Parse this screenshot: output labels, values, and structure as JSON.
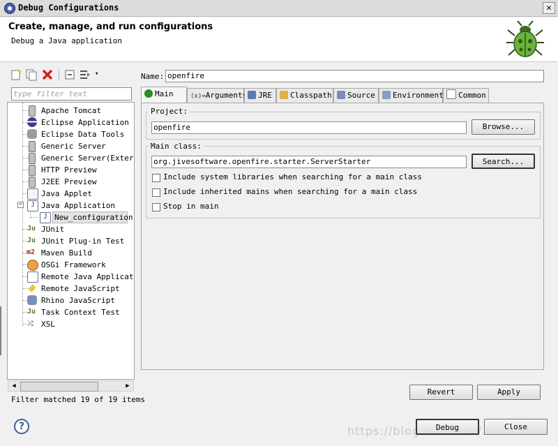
{
  "window": {
    "title": "Debug Configurations",
    "close_icon": "close-icon"
  },
  "header": {
    "title": "Create, manage, and run configurations",
    "subtitle": "Debug a Java application",
    "icon": "debug-bug-icon"
  },
  "left_panel": {
    "toolbar": [
      {
        "icon": "new-launch-config-icon"
      },
      {
        "icon": "duplicate-icon"
      },
      {
        "icon": "delete-icon"
      },
      {
        "icon": "collapse-all-icon"
      },
      {
        "icon": "filter-icon"
      },
      {
        "icon": "view-menu-dropdown-icon"
      }
    ],
    "filter_placeholder": "type filter text",
    "tree": [
      {
        "label": "Apache Tomcat",
        "icon": "tomcat-icon"
      },
      {
        "label": "Eclipse Application",
        "icon": "eclipse-icon"
      },
      {
        "label": "Eclipse Data Tools",
        "icon": "database-icon"
      },
      {
        "label": "Generic Server",
        "icon": "server-icon"
      },
      {
        "label": "Generic Server(Externa",
        "icon": "server-icon"
      },
      {
        "label": "HTTP Preview",
        "icon": "server-icon"
      },
      {
        "label": "J2EE Preview",
        "icon": "server-icon"
      },
      {
        "label": "Java Applet",
        "icon": "applet-icon"
      },
      {
        "label": "Java Application",
        "icon": "java-app-icon",
        "expanded": true,
        "children": [
          {
            "label": "New_configuration",
            "icon": "java-app-icon",
            "selected": true
          }
        ]
      },
      {
        "label": "JUnit",
        "icon": "junit-icon"
      },
      {
        "label": "JUnit Plug-in Test",
        "icon": "junit-plugin-icon"
      },
      {
        "label": "Maven Build",
        "icon": "maven-icon"
      },
      {
        "label": "OSGi Framework",
        "icon": "osgi-icon"
      },
      {
        "label": "Remote Java Applicatio",
        "icon": "remote-java-icon"
      },
      {
        "label": "Remote JavaScript",
        "icon": "remote-js-icon"
      },
      {
        "label": "Rhino JavaScript",
        "icon": "rhino-icon"
      },
      {
        "label": "Task Context Test",
        "icon": "task-context-icon"
      },
      {
        "label": "XSL",
        "icon": "xsl-icon"
      }
    ],
    "filter_status": "Filter matched 19 of 19 items"
  },
  "config": {
    "name_label": "Name:",
    "name_value": "openfire",
    "tabs": [
      {
        "label": "Main",
        "icon": "main-tab-icon",
        "active": true
      },
      {
        "label": "Arguments",
        "icon": "arguments-icon"
      },
      {
        "label": "JRE",
        "icon": "jre-icon"
      },
      {
        "label": "Classpath",
        "icon": "classpath-icon"
      },
      {
        "label": "Source",
        "icon": "source-icon"
      },
      {
        "label": "Environment",
        "icon": "environment-icon"
      },
      {
        "label": "Common",
        "icon": "common-icon"
      }
    ],
    "project_label": "Project:",
    "project_value": "openfire",
    "browse_label": "Browse...",
    "main_class_label": "Main class:",
    "main_class_value": "org.jivesoftware.openfire.starter.ServerStarter",
    "search_label": "Search...",
    "options": [
      {
        "label": "Include system libraries when searching for a main class",
        "checked": false
      },
      {
        "label": "Include inherited mains when searching for a main class",
        "checked": false
      },
      {
        "label": "Stop in main",
        "checked": false
      }
    ]
  },
  "buttons": {
    "revert": "Revert",
    "apply": "Apply",
    "debug": "Debug",
    "close": "Close"
  },
  "help_icon": "help-icon",
  "watermark": "https://blog.csdn.net/..."
}
